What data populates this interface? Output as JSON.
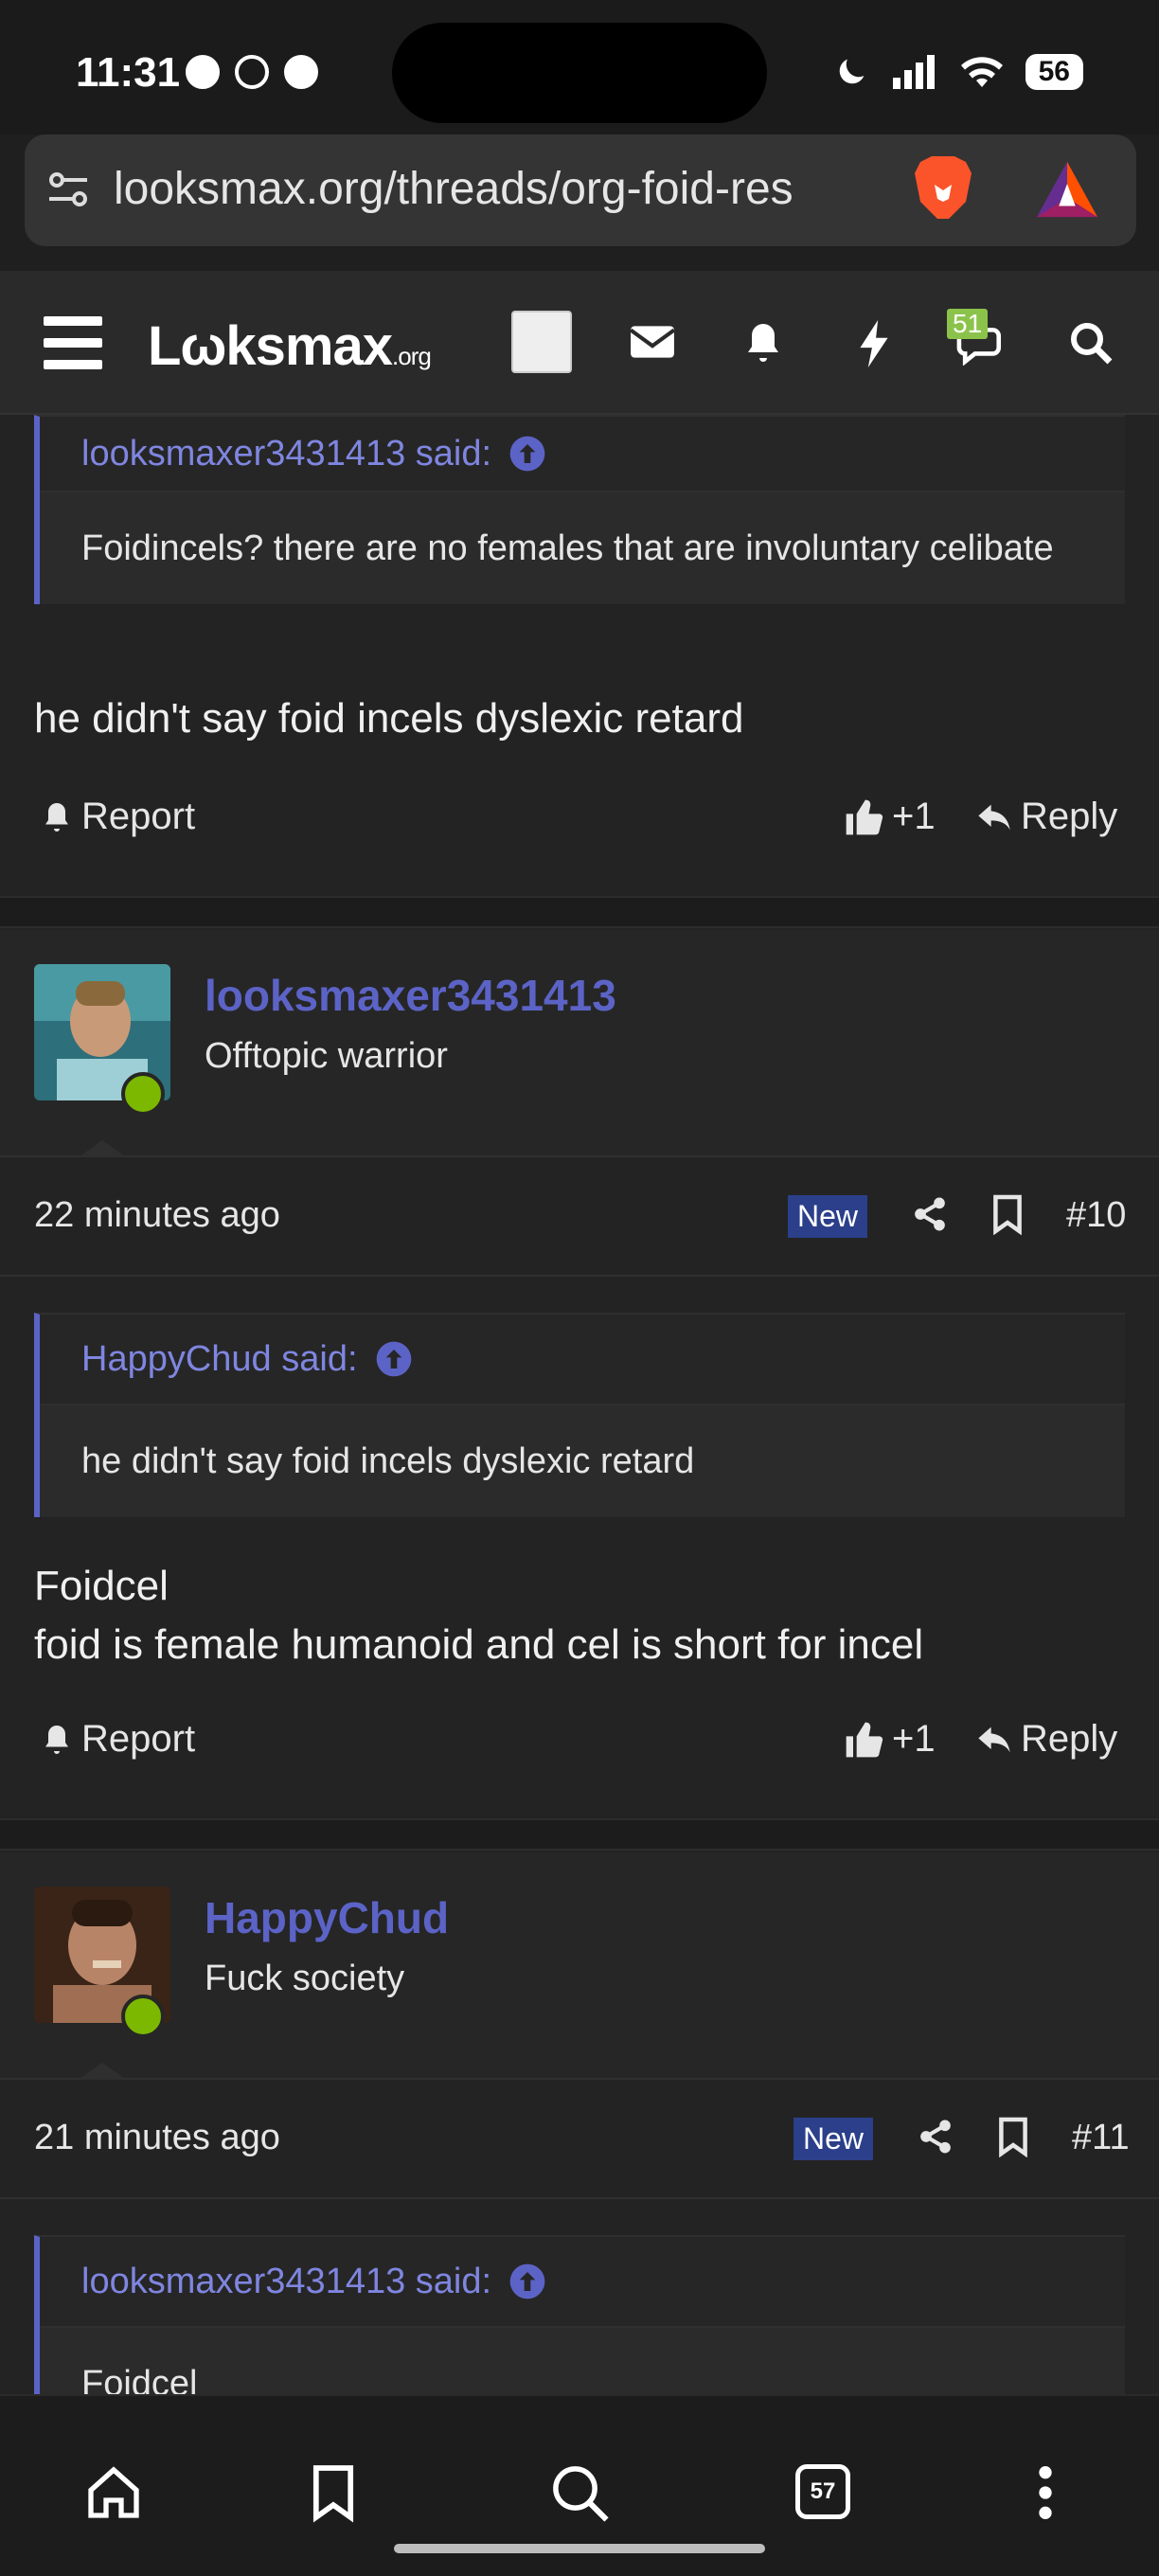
{
  "status": {
    "time": "11:31",
    "battery": "56"
  },
  "browser": {
    "url": "looksmax.org/threads/org-foid-res",
    "tab_count": "57"
  },
  "site": {
    "logo_main": "Lωksmax",
    "logo_suffix": ".org",
    "conversation_badge": "51"
  },
  "posts": [
    {
      "quote_author": "looksmaxer3431413 said:",
      "quote_text": "Foidincels? there are no females that are involuntary celibate",
      "message": "he didn't say foid incels dyslexic retard",
      "report_label": "Report",
      "reaction": "+1",
      "reply_label": "Reply"
    },
    {
      "username": "looksmaxer3431413",
      "user_title": "Offtopic warrior",
      "time": "22 minutes ago",
      "new_label": "New",
      "post_number": "#10",
      "quote_author": "HappyChud said:",
      "quote_text": "he didn't say foid incels dyslexic retard",
      "message_line1": "Foidcel",
      "message_line2": "foid is female humanoid and cel is short for incel",
      "report_label": "Report",
      "reaction": "+1",
      "reply_label": "Reply"
    },
    {
      "username": "HappyChud",
      "user_title": "Fuck society",
      "time": "21 minutes ago",
      "new_label": "New",
      "post_number": "#11",
      "quote_author": "looksmaxer3431413 said:",
      "quote_text": "Foidcel"
    }
  ],
  "colors": {
    "accent": "#5c63c6",
    "online": "#7cb800",
    "new_badge": "#2b3f8a"
  }
}
